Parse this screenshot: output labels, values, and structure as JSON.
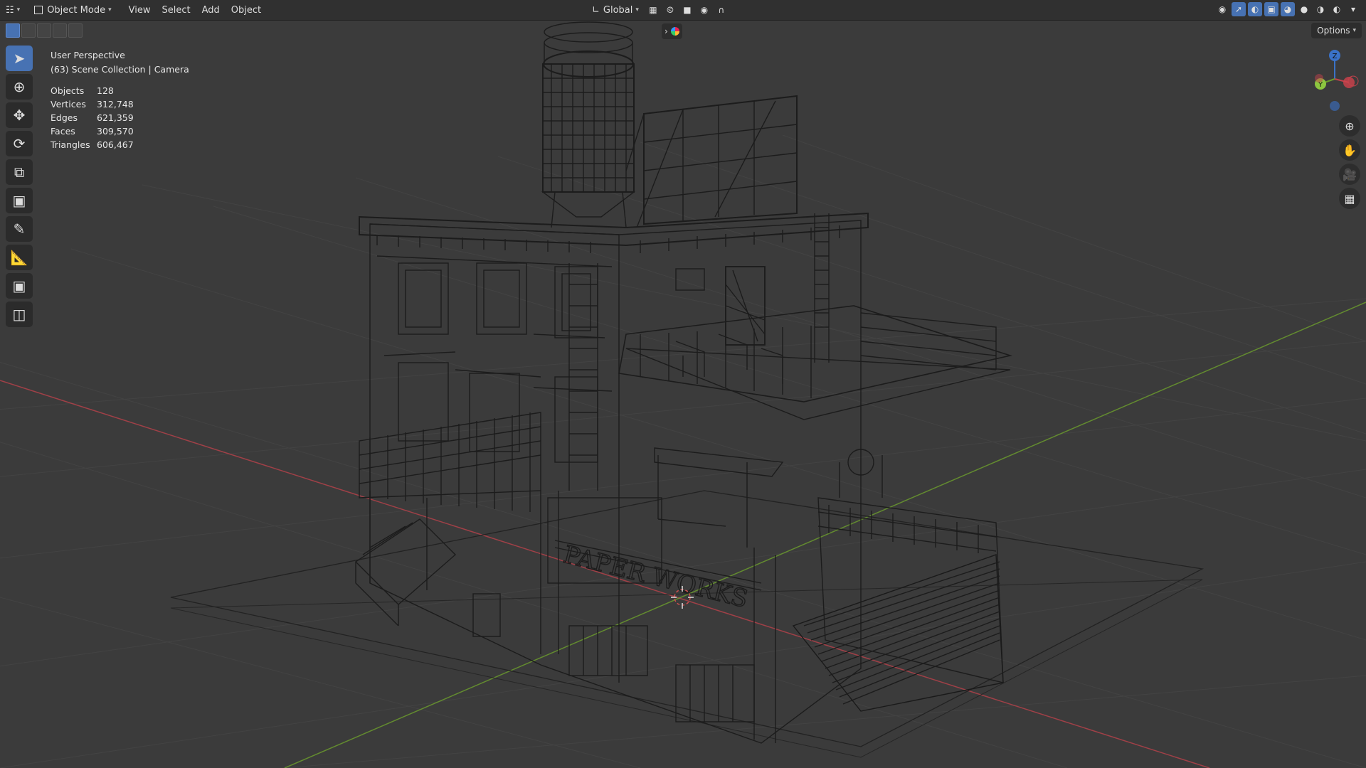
{
  "header": {
    "mode_label": "Object Mode",
    "menus": [
      "View",
      "Select",
      "Add",
      "Object"
    ],
    "orientation_label": "Global",
    "editor_icon": "editor-type-icon"
  },
  "overlay": {
    "perspective": "User Perspective",
    "collection": "(63) Scene Collection | Camera"
  },
  "stats": [
    {
      "label": "Objects",
      "value": "128"
    },
    {
      "label": "Vertices",
      "value": "312,748"
    },
    {
      "label": "Edges",
      "value": "621,359"
    },
    {
      "label": "Faces",
      "value": "309,570"
    },
    {
      "label": "Triangles",
      "value": "606,467"
    }
  ],
  "options_label": "Options",
  "gizmo": {
    "z": "Z",
    "y": "Y"
  },
  "tools": [
    {
      "name": "select-box-icon"
    },
    {
      "name": "cursor-icon"
    },
    {
      "name": "move-icon"
    },
    {
      "name": "rotate-icon"
    },
    {
      "name": "scale-icon"
    },
    {
      "name": "transform-icon"
    },
    {
      "name": "annotate-icon"
    },
    {
      "name": "measure-icon"
    },
    {
      "name": "add-cube-icon"
    },
    {
      "name": "add-object-icon"
    }
  ],
  "model_text": "PAPER WORKS",
  "colors": {
    "accent": "#4772b3",
    "x_axis": "#c2424c",
    "y_axis": "#6a9a2e",
    "z_axis": "#3a72c8",
    "background": "#3b3b3b"
  }
}
